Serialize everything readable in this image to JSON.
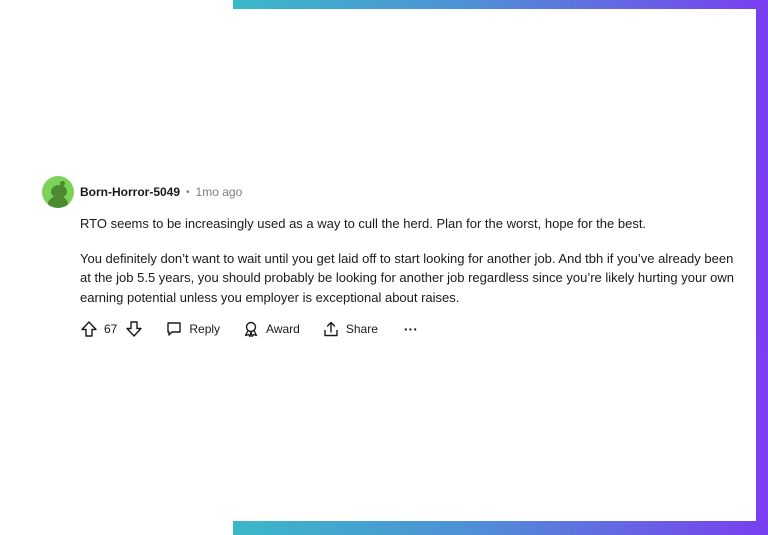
{
  "comment": {
    "username": "Born-Horror-5049",
    "separator": "•",
    "timestamp": "1mo ago",
    "paragraphs": [
      "RTO seems to be increasingly used as a way to cull the herd. Plan for the worst, hope for the best.",
      "You definitely don’t want to wait until you get laid off to start looking for another job. And tbh if you’ve already been at the job 5.5 years, you should probably be looking for another job regardless since you’re likely hurting your own earning potential unless you employer is exceptional about raises."
    ],
    "actions": {
      "vote_count": "67",
      "reply_label": "Reply",
      "award_label": "Award",
      "share_label": "Share",
      "more_label": "···"
    }
  },
  "colors": {
    "avatar_bg": "#7bd35a",
    "avatar_fg": "#4c8a2f",
    "frame_start": "#3bb8c8",
    "frame_end": "#7a3ff0",
    "meta_text": "#7c7c7c"
  }
}
